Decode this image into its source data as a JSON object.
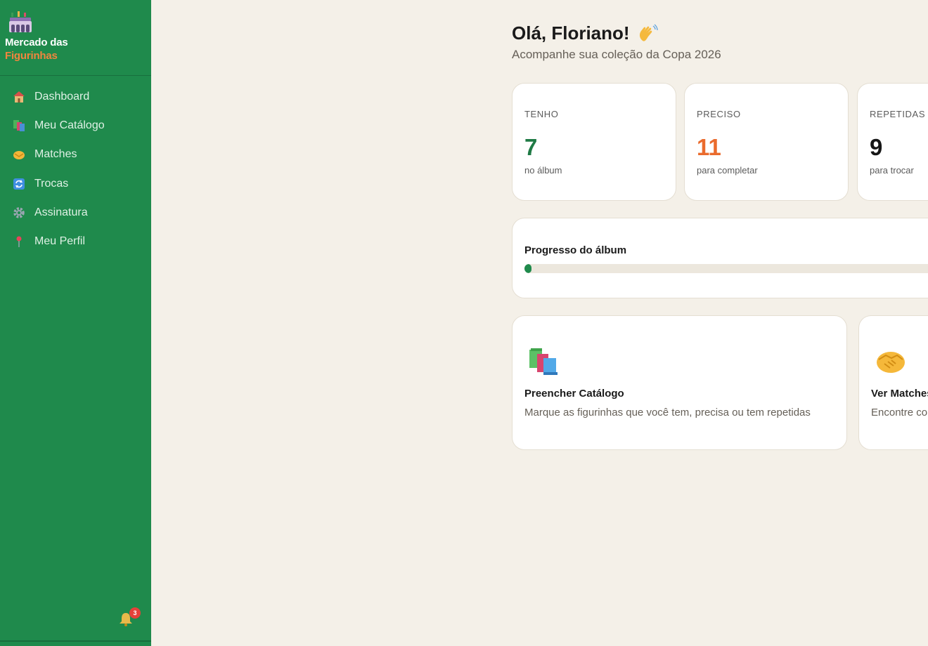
{
  "brand": {
    "line1": "Mercado das",
    "line2": "Figurinhas",
    "logo_icon": "stadium-icon"
  },
  "sidebar": {
    "items": [
      {
        "label": "Dashboard",
        "icon": "house-icon"
      },
      {
        "label": "Meu Catálogo",
        "icon": "books-icon"
      },
      {
        "label": "Matches",
        "icon": "handshake-icon"
      },
      {
        "label": "Trocas",
        "icon": "swap-icon"
      },
      {
        "label": "Assinatura",
        "icon": "gear-icon"
      },
      {
        "label": "Meu Perfil",
        "icon": "pin-icon"
      }
    ],
    "notifications": {
      "count": "3",
      "icon": "bell-icon"
    }
  },
  "header": {
    "greeting": "Olá, Floriano!",
    "greeting_icon": "waving-hand-icon",
    "subtitle": "Acompanhe sua coleção da Copa 2026"
  },
  "stats": [
    {
      "label": "TENHO",
      "value": "7",
      "caption": "no álbum",
      "color": "#1f7a45"
    },
    {
      "label": "PRECISO",
      "value": "11",
      "caption": "para completar",
      "color": "#ea6b2d"
    },
    {
      "label": "REPETIDAS",
      "value": "9",
      "caption": "para trocar",
      "color": "#161616"
    }
  ],
  "progress": {
    "title": "Progresso do álbum",
    "fraction": 0.01
  },
  "actions": [
    {
      "title": "Preencher Catálogo",
      "desc": "Marque as figurinhas que você tem, precisa ou tem repetidas",
      "icon": "books-icon"
    },
    {
      "title": "Ver Matches",
      "desc": "Encontre colecionadores",
      "icon": "handshake-icon"
    }
  ],
  "colors": {
    "sidebar": "#1f8a4c",
    "accent_orange": "#f2853e",
    "background": "#f4f0e8"
  }
}
